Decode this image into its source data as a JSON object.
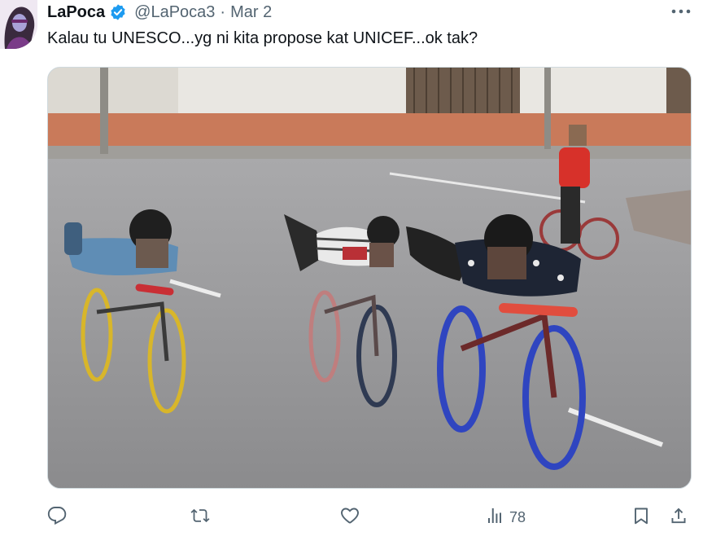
{
  "tweet": {
    "display_name": "LaPoca",
    "handle": "@LaPoca3",
    "separator": "·",
    "date": "Mar 2",
    "verified": true,
    "text": "Kalau tu UNESCO...yg ni kita propose kat UNICEF...ok tak?"
  },
  "media": {
    "subject": "photo"
  },
  "actions": {
    "reply_icon": "reply-icon",
    "retweet_icon": "retweet-icon",
    "like_icon": "heart-icon",
    "views_icon": "views-icon",
    "views_count": "78",
    "bookmark_icon": "bookmark-icon",
    "share_icon": "share-icon"
  },
  "colors": {
    "verified_blue": "#1d9bf0",
    "secondary_text": "#536471",
    "primary_text": "#0f1419"
  }
}
